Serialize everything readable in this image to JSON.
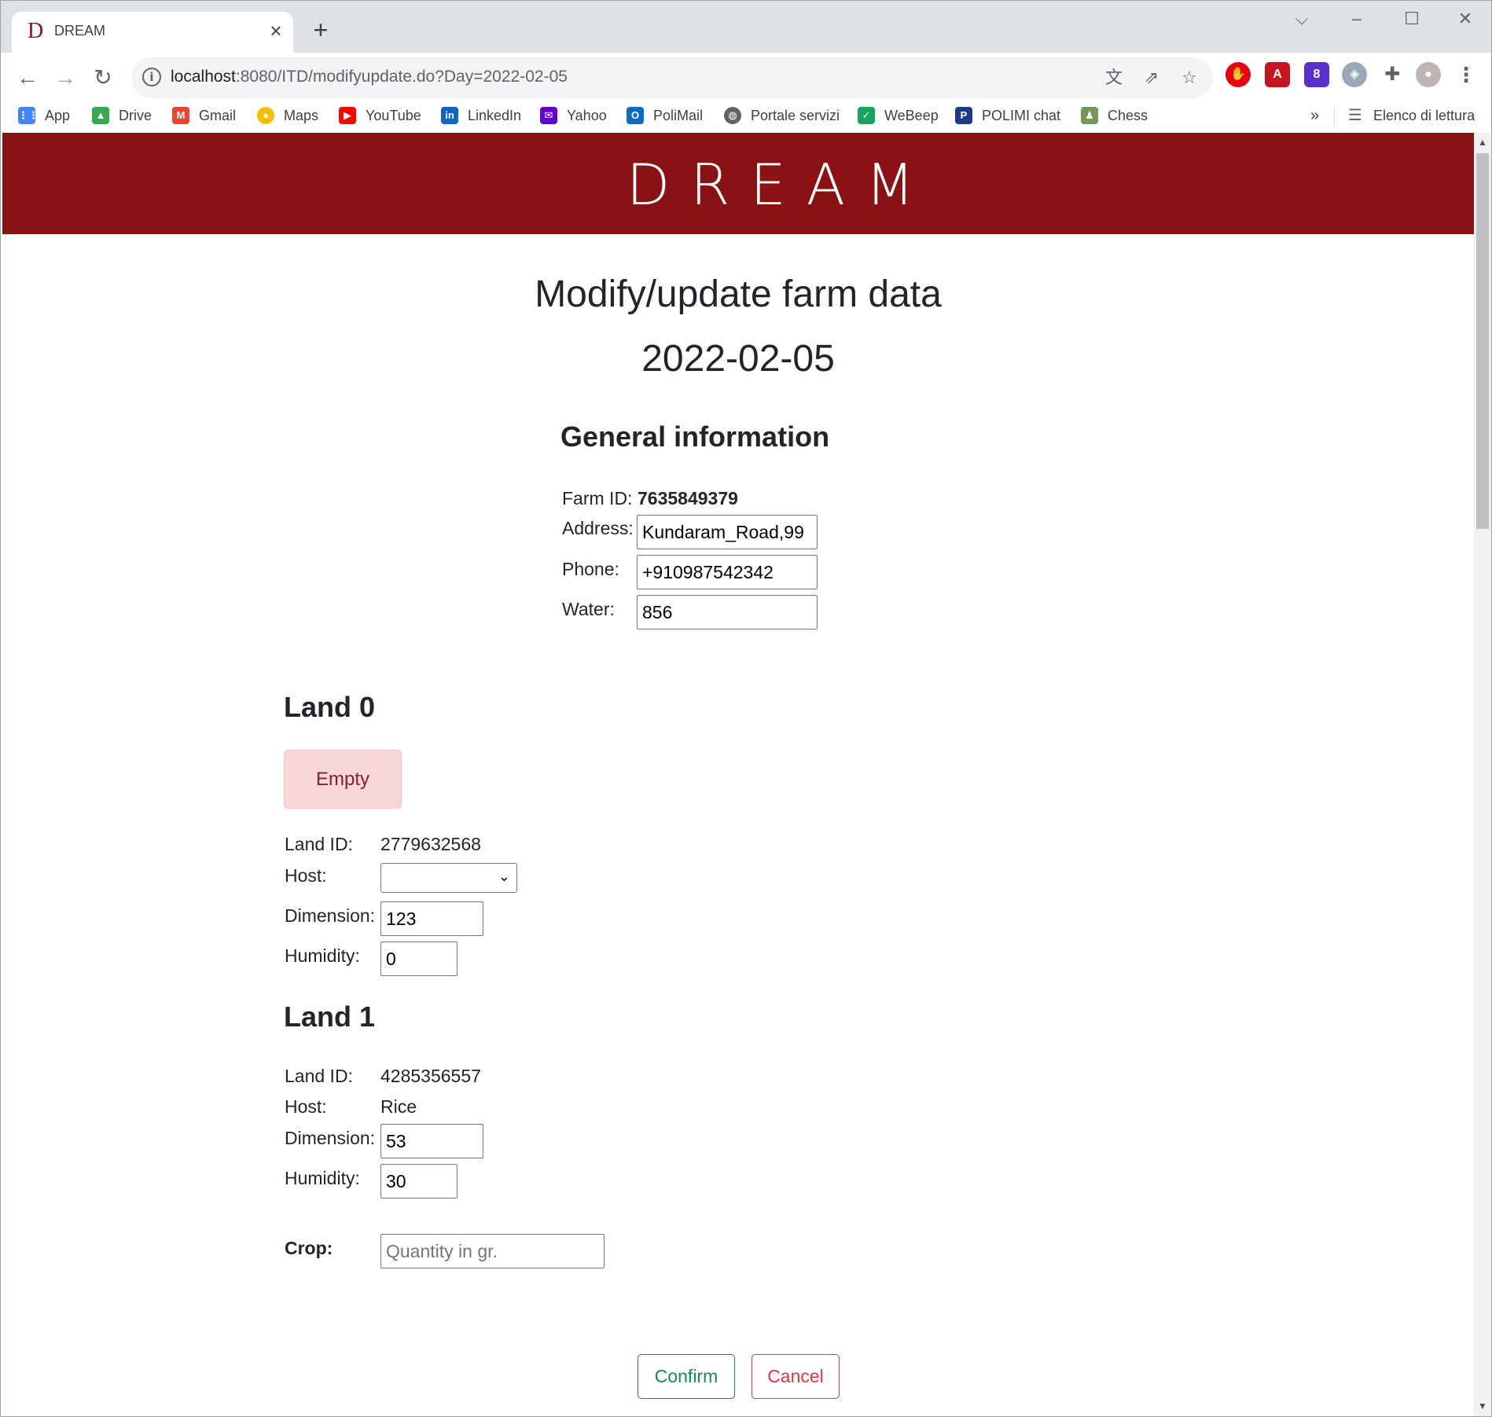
{
  "browser": {
    "tab_title": "DREAM",
    "favicon_letter": "D",
    "new_tab": "+",
    "close_tab": "×",
    "url_host": "localhost",
    "url_path": ":8080/ITD/modifyupdate.do?Day=2022-02-05",
    "bookmarks": [
      {
        "label": "App",
        "icon": "apps-grid-icon",
        "color": "#4285f4"
      },
      {
        "label": "Drive",
        "icon": "google-drive-icon",
        "color": "#34a853"
      },
      {
        "label": "Gmail",
        "icon": "gmail-icon",
        "color": "#ea4335"
      },
      {
        "label": "Maps",
        "icon": "google-maps-icon",
        "color": "#fbbc04"
      },
      {
        "label": "YouTube",
        "icon": "youtube-icon",
        "color": "#ff0000"
      },
      {
        "label": "LinkedIn",
        "icon": "linkedin-icon",
        "color": "#0a66c2"
      },
      {
        "label": "Yahoo",
        "icon": "yahoo-icon",
        "color": "#6001d2"
      },
      {
        "label": "PoliMail",
        "icon": "outlook-icon",
        "color": "#0f6cbd"
      },
      {
        "label": "Portale servizi",
        "icon": "globe-icon",
        "color": "#5f6368"
      },
      {
        "label": "WeBeep",
        "icon": "webeep-check-icon",
        "color": "#1aa260"
      },
      {
        "label": "POLIMI chat",
        "icon": "polimi-chat-icon",
        "color": "#1b3a8a"
      },
      {
        "label": "Chess",
        "icon": "chess-pawn-icon",
        "color": "#769656"
      }
    ],
    "bookmarks_overflow": "»",
    "reading_list": "Elenco di lettura"
  },
  "page": {
    "logo": "DREAM",
    "title": "Modify/update farm data",
    "date": "2022-02-05",
    "general": {
      "heading": "General information",
      "farm_id_label": "Farm ID:",
      "farm_id": "7635849379",
      "address_label": "Address:",
      "address": "Kundaram_Road,99",
      "phone_label": "Phone:",
      "phone": "+910987542342",
      "water_label": "Water:",
      "water": "856"
    },
    "lands": [
      {
        "heading": "Land 0",
        "status": "Empty",
        "land_id_label": "Land ID:",
        "land_id": "2779632568",
        "host_label": "Host:",
        "host": "",
        "dimension_label": "Dimension:",
        "dimension": "123",
        "humidity_label": "Humidity:",
        "humidity": "0"
      },
      {
        "heading": "Land 1",
        "land_id_label": "Land ID:",
        "land_id": "4285356557",
        "host_label": "Host:",
        "host": "Rice",
        "dimension_label": "Dimension:",
        "dimension": "53",
        "humidity_label": "Humidity:",
        "humidity": "30",
        "crop_label": "Crop:",
        "crop_placeholder": "Quantity in gr."
      }
    ],
    "confirm": "Confirm",
    "cancel": "Cancel"
  },
  "colors": {
    "banner": "#8b1214",
    "confirm": "#198754",
    "cancel": "#dc3545",
    "empty_badge_bg": "#f8d7da",
    "empty_badge_text": "#842029"
  }
}
